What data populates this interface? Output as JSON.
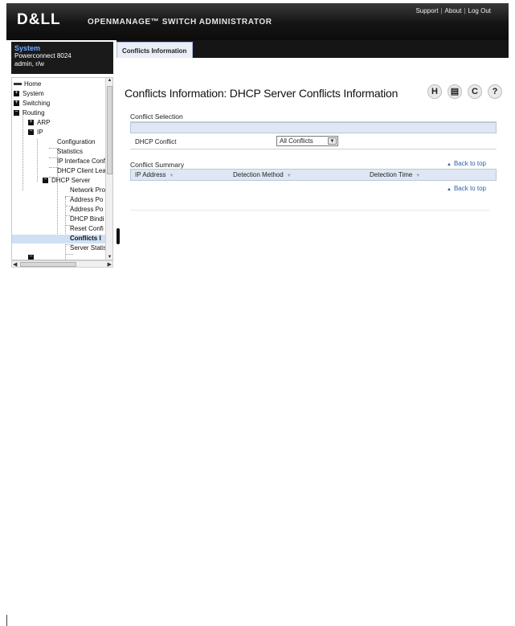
{
  "header": {
    "logo": "D&LL",
    "title": "OPENMANAGE™ SWITCH ADMINISTRATOR",
    "links": [
      "Support",
      "About",
      "Log Out"
    ]
  },
  "system_box": {
    "title": "System",
    "model": "Powerconnect 8024",
    "user": "admin, r/w"
  },
  "tree": {
    "home": "Home",
    "system": "System",
    "switching": "Switching",
    "routing": "Routing",
    "arp": "ARP",
    "ip": "IP",
    "configuration": "Configuration",
    "statistics": "Statistics",
    "ip_interface": "IP Interface Conf",
    "dhcp_client": "DHCP Client Lea",
    "dhcp_server": "DHCP Server",
    "network_pro": "Network Pro",
    "address_po1": "Address Po",
    "address_po2": "Address Po",
    "dhcp_bind": "DHCP Bindi",
    "reset_conf": "Reset Confi",
    "conflicts": "Conflicts I",
    "server_stats": "Server Statis"
  },
  "tab": {
    "label": "Conflicts Information"
  },
  "page": {
    "title": "Conflicts Information: DHCP Server Conflicts Information",
    "icons": [
      "save-icon",
      "print-icon",
      "refresh-icon",
      "help-icon"
    ],
    "icon_glyphs": [
      "H",
      "▤",
      "C",
      "?"
    ]
  },
  "conflict_selection": {
    "label": "Conflict Selection",
    "field_label": "DHCP Conflict",
    "selected": "All Conflicts"
  },
  "conflict_summary": {
    "label": "Conflict Summary",
    "back_to_top": "Back to top",
    "columns": [
      "IP Address",
      "Detection Method",
      "Detection Time"
    ],
    "back_to_top_2": "Back to top"
  }
}
